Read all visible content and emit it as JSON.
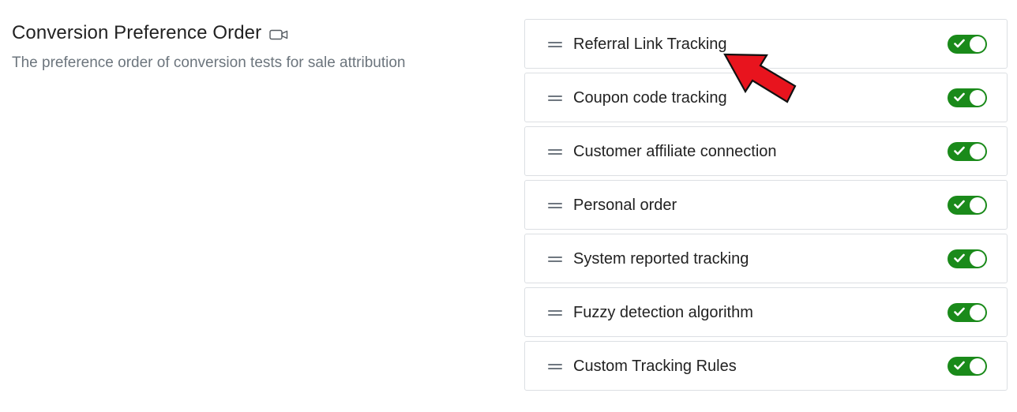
{
  "section": {
    "title": "Conversion Preference Order",
    "title_icon": "video-camera-icon",
    "description": "The preference order of conversion tests for sale attribution"
  },
  "items": [
    {
      "label": "Referral Link Tracking",
      "enabled": true
    },
    {
      "label": "Coupon code tracking",
      "enabled": true
    },
    {
      "label": "Customer affiliate connection",
      "enabled": true
    },
    {
      "label": "Personal order",
      "enabled": true
    },
    {
      "label": "System reported tracking",
      "enabled": true
    },
    {
      "label": "Fuzzy detection algorithm",
      "enabled": true
    },
    {
      "label": "Custom Tracking Rules",
      "enabled": true
    }
  ],
  "icons": {
    "drag_handle": "drag-handle-icon",
    "toggle_on": "check-icon"
  },
  "colors": {
    "toggle_on": "#1a8a1a",
    "annotation_arrow": "#e8141e",
    "text_primary": "#222222",
    "text_muted": "#6c757d",
    "border": "#dcdfe3"
  }
}
